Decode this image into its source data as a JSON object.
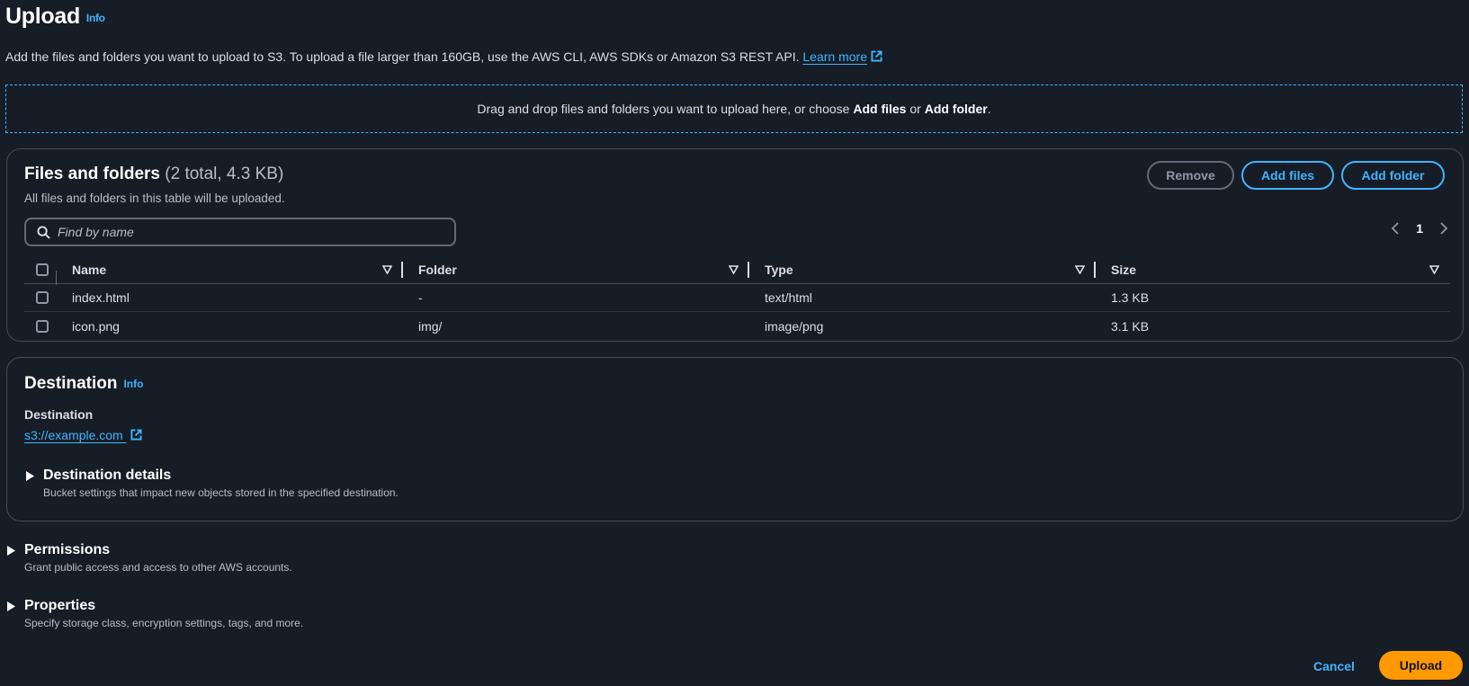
{
  "header": {
    "title": "Upload",
    "info_label": "Info",
    "description": "Add the files and folders you want to upload to S3. To upload a file larger than 160GB, use the AWS CLI, AWS SDKs or Amazon S3 REST API.",
    "learn_more_label": "Learn more"
  },
  "dropzone": {
    "text_prefix": "Drag and drop files and folders you want to upload here, or choose ",
    "add_files": "Add files",
    "or": " or ",
    "add_folder": "Add folder",
    "suffix": "."
  },
  "files_panel": {
    "title": "Files and folders",
    "count": "(2 total, 4.3 KB)",
    "description": "All files and folders in this table will be uploaded.",
    "buttons": {
      "remove": "Remove",
      "add_files": "Add files",
      "add_folder": "Add folder"
    },
    "search": {
      "placeholder": "Find by name",
      "value": ""
    },
    "pagination": {
      "current_page": "1"
    },
    "columns": [
      "Name",
      "Folder",
      "Type",
      "Size"
    ],
    "rows": [
      {
        "name": "index.html",
        "folder": "-",
        "type": "text/html",
        "size": "1.3 KB"
      },
      {
        "name": "icon.png",
        "folder": "img/",
        "type": "image/png",
        "size": "3.1 KB"
      }
    ]
  },
  "destination_panel": {
    "title": "Destination",
    "info_label": "Info",
    "label": "Destination",
    "value": "s3://example.com",
    "details": {
      "title": "Destination details",
      "description": "Bucket settings that impact new objects stored in the specified destination."
    }
  },
  "permissions": {
    "title": "Permissions",
    "description": "Grant public access and access to other AWS accounts."
  },
  "properties": {
    "title": "Properties",
    "description": "Specify storage class, encryption settings, tags, and more."
  },
  "footer": {
    "cancel": "Cancel",
    "upload": "Upload"
  },
  "colors": {
    "background": "#161d26",
    "link": "#42b4ff",
    "primary_button": "#ff9900",
    "border": "#414d5c"
  }
}
